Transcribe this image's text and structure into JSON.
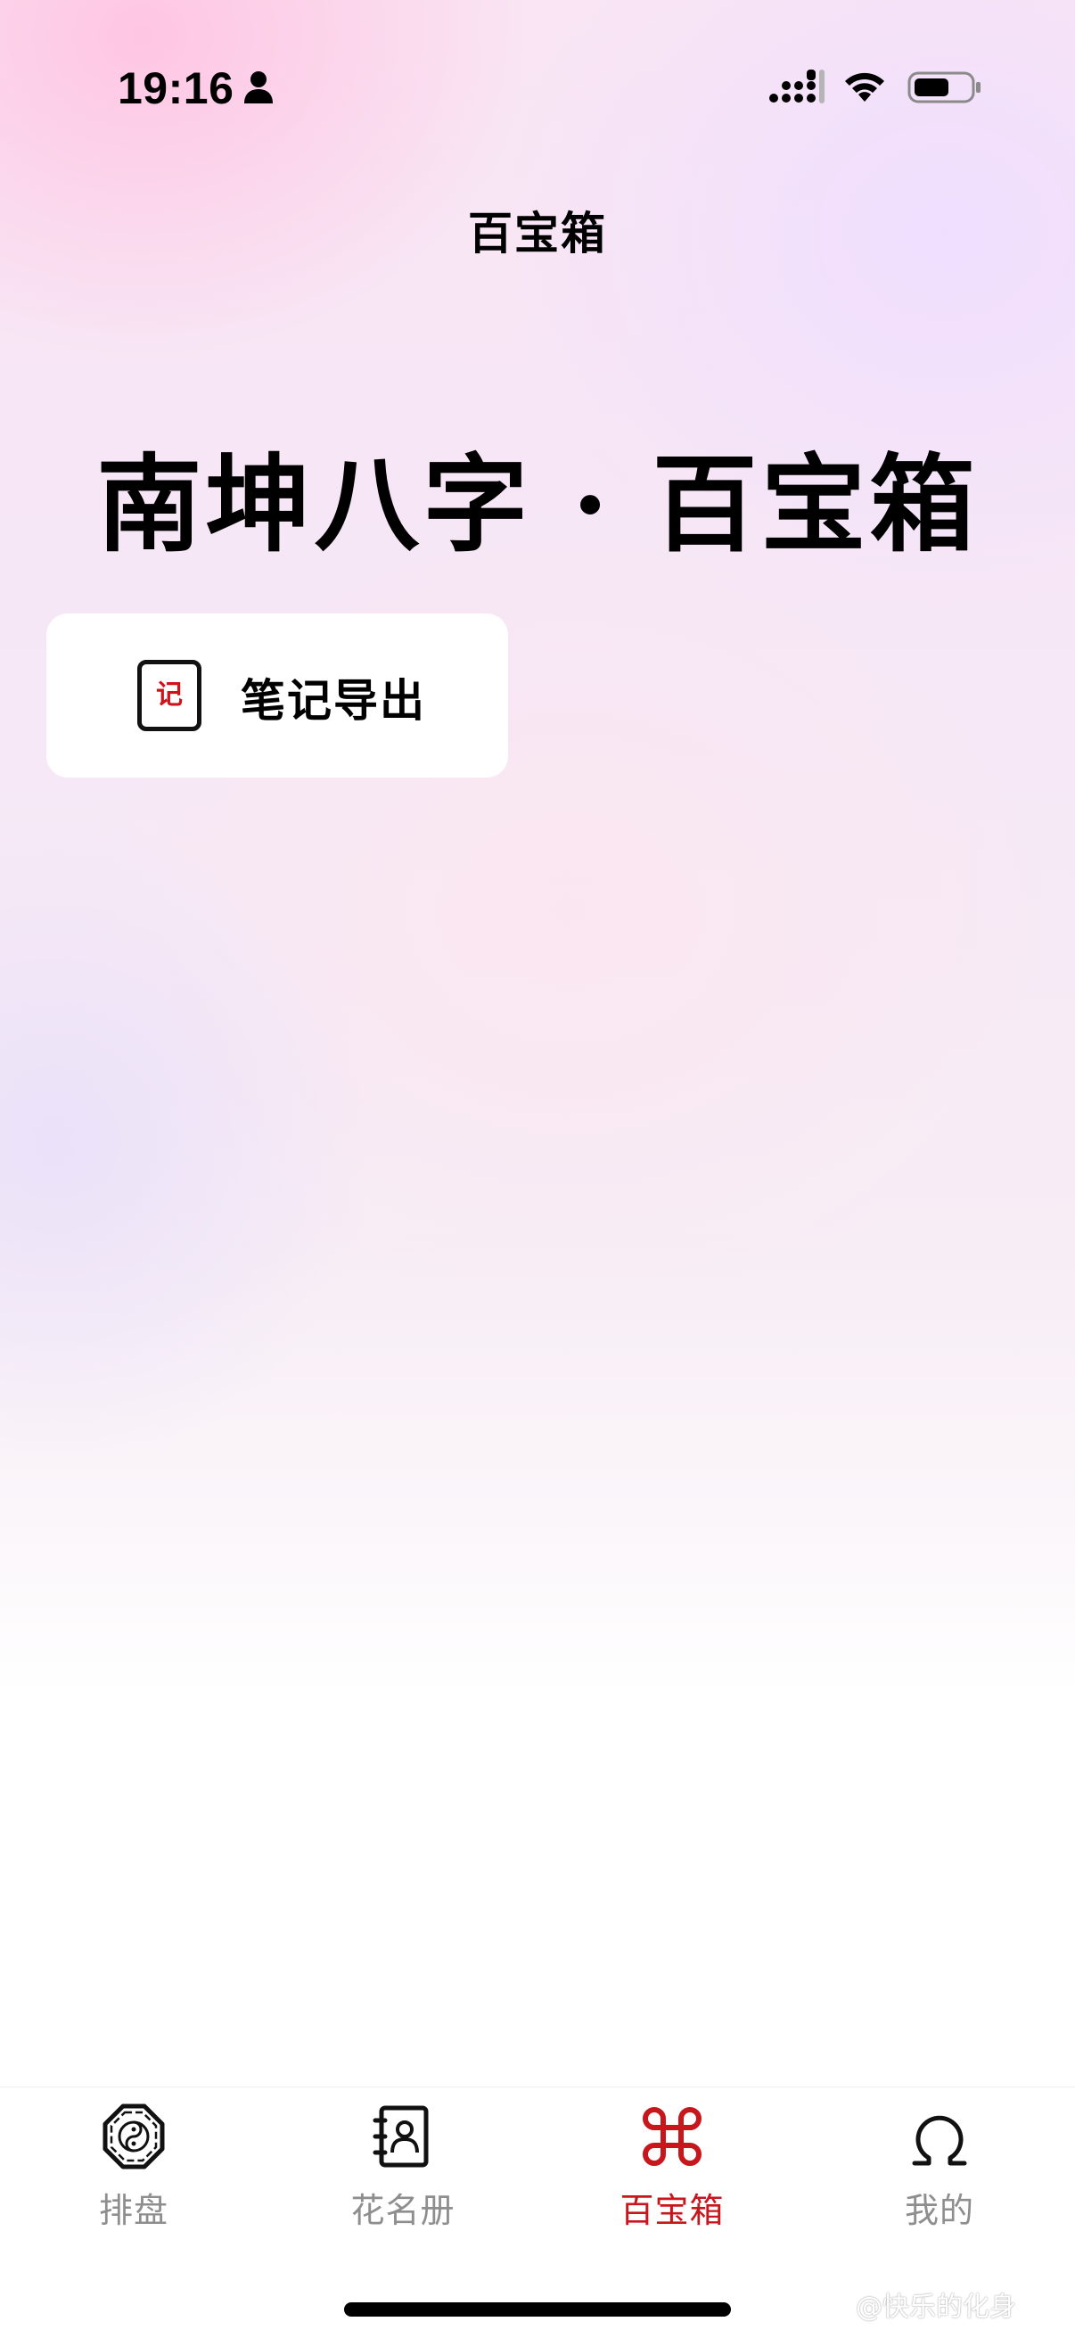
{
  "status_bar": {
    "time": "19:16"
  },
  "nav": {
    "title": "百宝箱"
  },
  "hero": {
    "title": "南坤八字 · 百宝箱"
  },
  "tools": [
    {
      "icon_glyph": "记",
      "label": "笔记导出",
      "icon": "note-export-icon"
    }
  ],
  "tabbar": {
    "active_color": "#c8161d",
    "inactive_color": "#8e8e8e",
    "items": [
      {
        "label": "排盘",
        "icon": "bagua-icon"
      },
      {
        "label": "花名册",
        "icon": "contact-book-icon"
      },
      {
        "label": "百宝箱",
        "icon": "command-icon",
        "active": true
      },
      {
        "label": "我的",
        "icon": "omega-profile-icon"
      }
    ]
  },
  "watermark": {
    "text": "@快乐的化身"
  }
}
